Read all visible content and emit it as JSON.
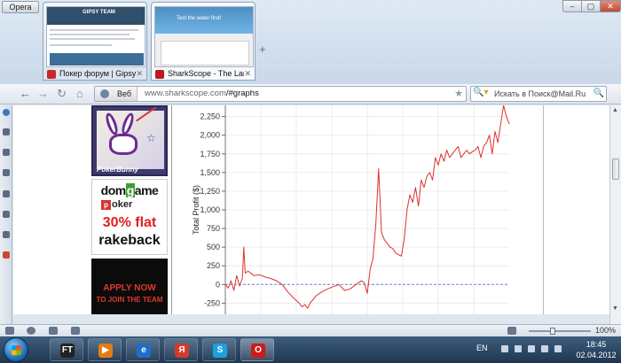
{
  "browser": {
    "menu_label": "Opera",
    "window_controls": {
      "minimize": "–",
      "maximize": "▢",
      "close": "✕"
    },
    "new_tab": "+",
    "tabs": [
      {
        "title": "Покер форум | Gipsy...",
        "close": "✕",
        "active": false,
        "thumb_logo": "GIPSY TEAM"
      },
      {
        "title": "SharkScope - The Larg...",
        "close": "✕",
        "active": true,
        "thumb_banner": "Test the water first!"
      }
    ]
  },
  "toolbar": {
    "back": "←",
    "forward": "→",
    "reload": "↻",
    "home": "⌂",
    "site_label": "Веб",
    "url_domain": "www.sharkscope.com",
    "url_path": "/#graphs",
    "bookmark_star": "★",
    "search_engine": "🔍▾",
    "search_placeholder": "Искать в Поиск@Mail.Ru",
    "search_button": "🔍"
  },
  "ads": {
    "bunny_caption": "PokerBunny",
    "dom_logo_prefix": "dom",
    "dom_logo_g": "g",
    "dom_logo_suffix": "ame",
    "dom_poker_badge": "p",
    "dom_poker_text": "oker",
    "dom_percent": "30% flat",
    "dom_rakeback": "rakeback",
    "apply_line1": "APPLY NOW",
    "apply_line2": "TO JOIN THE TEAM"
  },
  "chart_data": {
    "type": "line",
    "ylabel": "Total Profit ($)",
    "yticks": [
      -250,
      0,
      250,
      500,
      750,
      1000,
      1250,
      1500,
      1750,
      2000,
      2250
    ],
    "ytick_labels": [
      "-250",
      "0",
      "250",
      "500",
      "750",
      "1,000",
      "1,250",
      "1,500",
      "1,750",
      "2,000",
      "2,250"
    ],
    "ylim": [
      -400,
      2400
    ],
    "xlim": [
      0,
      100
    ],
    "zero_line": "dashed-blue",
    "grid": true,
    "series": [
      {
        "color": "#e03030",
        "x": [
          0,
          1,
          2,
          3,
          4,
          5,
          6,
          6.5,
          7,
          8,
          10,
          12,
          14,
          16,
          18,
          20,
          22,
          24,
          26,
          27,
          28,
          29,
          30,
          31,
          32,
          34,
          36,
          38,
          40,
          42,
          44,
          46,
          48,
          49,
          50,
          51,
          52,
          53,
          54,
          55,
          56,
          57,
          58,
          59,
          60,
          61,
          62,
          63,
          64,
          65,
          66,
          67,
          68,
          69,
          70,
          71,
          72,
          73,
          74,
          75,
          76,
          77,
          78,
          79,
          80,
          81,
          82,
          83,
          84,
          85,
          86,
          87,
          88,
          89,
          90,
          91,
          92,
          93,
          94,
          95,
          96,
          97,
          98,
          99,
          100
        ],
        "y": [
          0,
          -50,
          50,
          -80,
          120,
          -20,
          80,
          500,
          150,
          180,
          120,
          130,
          100,
          80,
          50,
          0,
          -100,
          -180,
          -250,
          -300,
          -270,
          -320,
          -240,
          -200,
          -150,
          -100,
          -60,
          -30,
          0,
          -80,
          -60,
          0,
          50,
          20,
          -120,
          200,
          350,
          800,
          1550,
          700,
          600,
          550,
          500,
          480,
          420,
          400,
          380,
          600,
          1000,
          1200,
          1100,
          1300,
          1050,
          1400,
          1300,
          1450,
          1500,
          1400,
          1700,
          1600,
          1750,
          1650,
          1800,
          1700,
          1750,
          1800,
          1850,
          1700,
          1750,
          1800,
          1750,
          1780,
          1800,
          1850,
          1700,
          1850,
          1900,
          2000,
          1750,
          2050,
          1900,
          2150,
          2400,
          2250,
          2150
        ]
      }
    ]
  },
  "statusbar": {
    "zoom_label": "100%"
  },
  "taskbar": {
    "apps": [
      {
        "name": "Full Tilt",
        "glyph": "FT",
        "color": "#222"
      },
      {
        "name": "Media Player",
        "glyph": "▶",
        "color": "#e27d12"
      },
      {
        "name": "Internet Explorer",
        "glyph": "e",
        "color": "#1d70c4"
      },
      {
        "name": "Yandex",
        "glyph": "Я",
        "color": "#d23a2a"
      },
      {
        "name": "Skype",
        "glyph": "S",
        "color": "#1ba1e2"
      },
      {
        "name": "Opera",
        "glyph": "O",
        "color": "#cc1a1a"
      }
    ],
    "language": "EN",
    "time": "18:45",
    "date": "02.04.2012"
  }
}
